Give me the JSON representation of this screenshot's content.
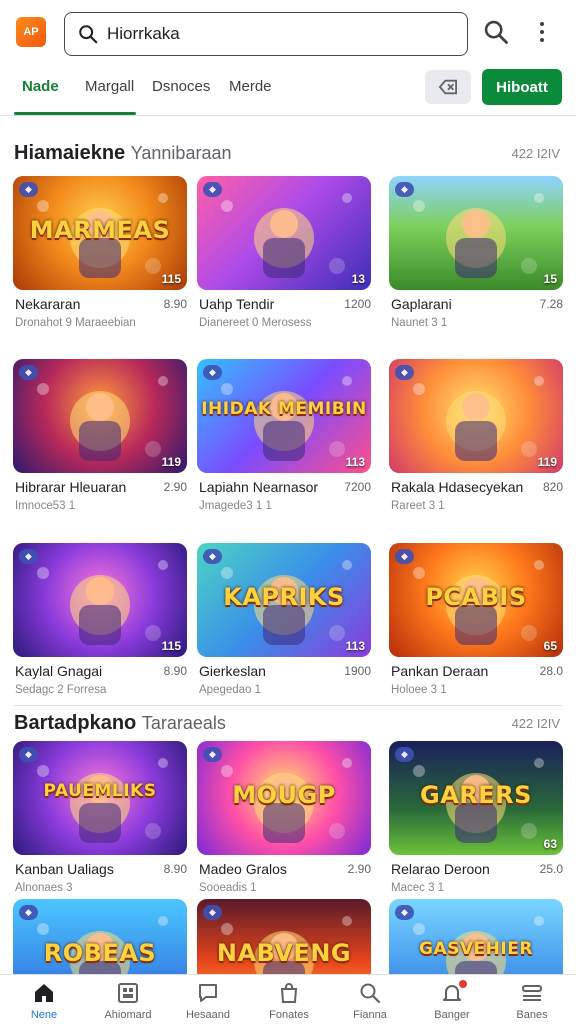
{
  "app": {
    "logo_text": "AP",
    "icon": "app-logo"
  },
  "search": {
    "value": "Hiorrkaka",
    "placeholder": ""
  },
  "tabs": [
    {
      "label": "Nade",
      "active": true
    },
    {
      "label": "Margall",
      "active": false
    },
    {
      "label": "Dsnoces",
      "active": false
    },
    {
      "label": "Merde",
      "active": false
    }
  ],
  "toolbar": {
    "filter_icon": "tag-icon",
    "primary_label": "Hiboatt"
  },
  "sections": [
    {
      "title_strong": "Hiamaiekne",
      "title_light": "Yannibaraan",
      "meta": "422 I2IV",
      "cards": [
        {
          "title": "Nekararan",
          "price": "8.90",
          "sub": "Dronahot 9 Maraeebian",
          "count": "115",
          "art": "MARMEAS",
          "theme": "orange"
        },
        {
          "title": "Uahp Tendir",
          "price": "1200",
          "sub": "Dianereet 0 Merosess",
          "count": "13",
          "art": "",
          "theme": "purple"
        },
        {
          "title": "Gaplarani",
          "price": "7.28",
          "sub": "Naunet 3 1",
          "count": "15",
          "art": "",
          "theme": "forest"
        },
        {
          "title": "Hibrarar Hleuaran",
          "price": "2.90",
          "sub": "Imnoce53 1",
          "count": "119",
          "art": "",
          "theme": "wizard"
        },
        {
          "title": "Lapiahn Nearnasor",
          "price": "7200",
          "sub": "Jmagede3 1 1",
          "count": "113",
          "art": "IHIDAK MEMIBIN",
          "theme": "blue"
        },
        {
          "title": "Rakala Hdasecyekan",
          "price": "820",
          "sub": "Rareet 3 1",
          "count": "119",
          "art": "",
          "theme": "party"
        },
        {
          "title": "Kaylal Gnagai",
          "price": "8.90",
          "sub": "Sedagc 2 Forresa",
          "count": "115",
          "art": "",
          "theme": "violet"
        },
        {
          "title": "Gierkeslan",
          "price": "1900",
          "sub": "Apegedao 1",
          "count": "113",
          "art": "KAPRIKS",
          "theme": "teal"
        },
        {
          "title": "Pankan Deraan",
          "price": "28.0",
          "sub": "Holoee 3 1",
          "count": "65",
          "art": "PCABIS",
          "theme": "sunset"
        }
      ]
    },
    {
      "title_strong": "Bartadpkano",
      "title_light": "Tararaeals",
      "meta": "422 I2IV",
      "cards": [
        {
          "title": "Kanban Ualiags",
          "price": "8.90",
          "sub": "Alnonaes 3",
          "count": "",
          "art": "PAUEMLIKS",
          "theme": "violet"
        },
        {
          "title": "Madeo Gralos",
          "price": "2.90",
          "sub": "Sooeadis 1",
          "count": "",
          "art": "MOUGP",
          "theme": "pink"
        },
        {
          "title": "Relarao Deroon",
          "price": "25.0",
          "sub": "Macec 3 1",
          "count": "63",
          "art": "GARERS",
          "theme": "dark"
        },
        {
          "title": "",
          "price": "",
          "sub": "",
          "count": "",
          "art": "ROBEAS",
          "theme": "sky"
        },
        {
          "title": "",
          "price": "",
          "sub": "",
          "count": "",
          "art": "NABVENG",
          "theme": "fire"
        },
        {
          "title": "",
          "price": "",
          "sub": "",
          "count": "",
          "art": "GASVEHIER",
          "theme": "skyblue"
        }
      ]
    }
  ],
  "bottom_nav": [
    {
      "label": "Nene",
      "icon": "home-icon",
      "active": true
    },
    {
      "label": "Ahiomard",
      "icon": "dashboard-icon",
      "active": false
    },
    {
      "label": "Hesaand",
      "icon": "chat-icon",
      "active": false
    },
    {
      "label": "Fonates",
      "icon": "bag-icon",
      "active": false
    },
    {
      "label": "Fianna",
      "icon": "search-icon",
      "active": false
    },
    {
      "label": "Banger",
      "icon": "bell-icon",
      "active": false
    },
    {
      "label": "Banes",
      "icon": "menu-icon",
      "active": false
    }
  ]
}
